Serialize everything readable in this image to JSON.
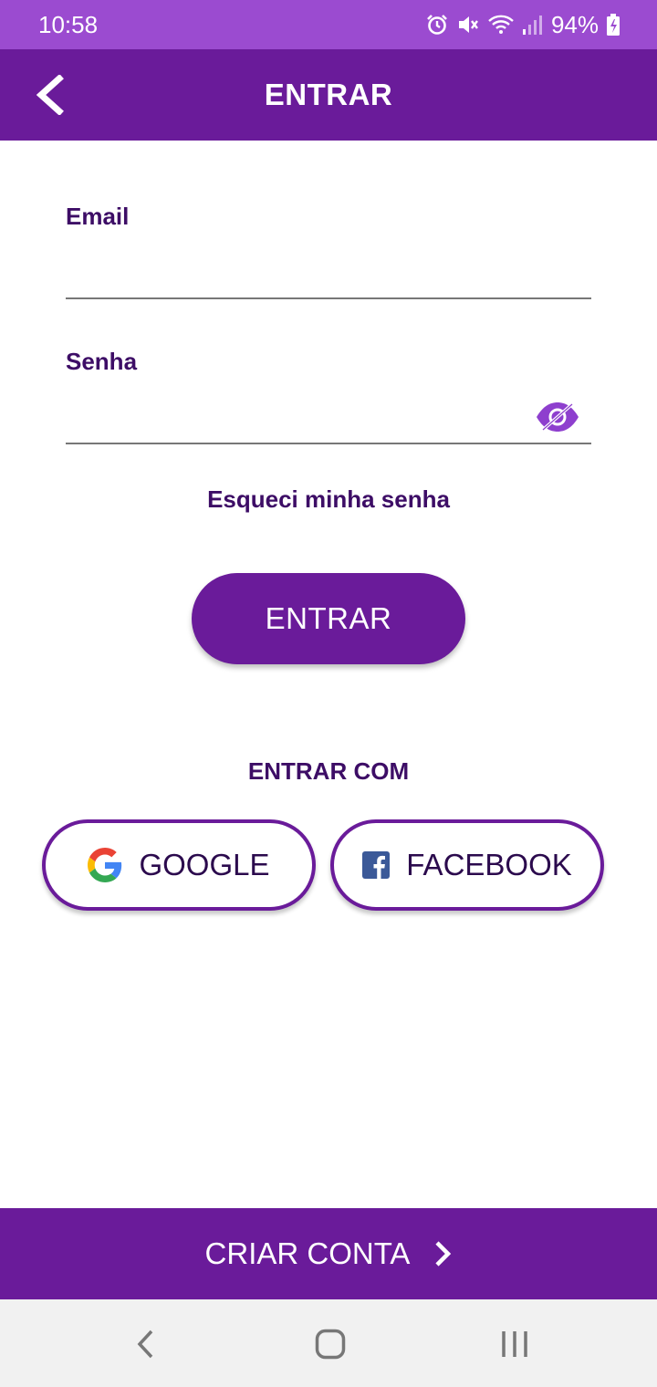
{
  "status_bar": {
    "time": "10:58",
    "battery": "94%",
    "icons": [
      "alarm-icon",
      "mute-icon",
      "wifi-icon",
      "signal-icon",
      "battery-charging-icon"
    ]
  },
  "app_bar": {
    "title": "ENTRAR",
    "back_icon": "chevron-left-icon",
    "background_color": "#6a1b9a"
  },
  "form": {
    "email_label": "Email",
    "email_value": "",
    "password_label": "Senha",
    "password_value": "",
    "password_toggle_icon": "eye-off-icon",
    "forgot_password": "Esqueci minha senha",
    "submit_label": "ENTRAR"
  },
  "social": {
    "label": "ENTRAR COM",
    "google_label": "GOOGLE",
    "google_icon": "google-icon",
    "facebook_label": "FACEBOOK",
    "facebook_icon": "facebook-icon"
  },
  "footer": {
    "create_account": "CRIAR CONTA",
    "arrow_icon": "chevron-right-icon"
  },
  "nav_bar": {
    "buttons": [
      "back-nav-icon",
      "home-nav-icon",
      "recents-nav-icon"
    ]
  },
  "colors": {
    "primary": "#6a1b9a",
    "status_bar": "#9b4bd0",
    "label_text": "#3d0d66",
    "eye_icon": "#8e3fce"
  }
}
